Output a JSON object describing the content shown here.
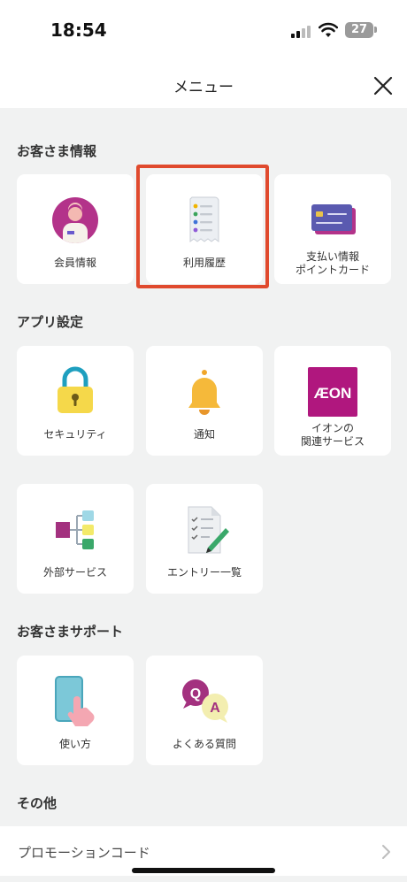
{
  "status_bar": {
    "time": "18:54",
    "battery": "27"
  },
  "header": {
    "title": "メニュー"
  },
  "sections": {
    "customer_info": {
      "title": "お客さま情報",
      "items": [
        {
          "label": "会員情報",
          "icon": "member-icon"
        },
        {
          "label": "利用履歴",
          "icon": "receipt-icon"
        },
        {
          "label": "支払い情報\nポイントカード",
          "icon": "card-icon"
        }
      ]
    },
    "app_settings": {
      "title": "アプリ設定",
      "items": [
        {
          "label": "セキュリティ",
          "icon": "lock-icon"
        },
        {
          "label": "通知",
          "icon": "bell-icon"
        },
        {
          "label": "イオンの\n関連サービス",
          "icon": "aeon-logo-icon"
        },
        {
          "label": "外部サービス",
          "icon": "connection-icon"
        },
        {
          "label": "エントリー一覧",
          "icon": "checklist-icon"
        }
      ]
    },
    "support": {
      "title": "お客さまサポート",
      "items": [
        {
          "label": "使い方",
          "icon": "phone-tap-icon"
        },
        {
          "label": "よくある質問",
          "icon": "qa-icon"
        }
      ]
    },
    "other": {
      "title": "その他",
      "items": [
        {
          "label": "プロモーションコード"
        }
      ]
    }
  },
  "logo_text": "ÆON",
  "faq_icon_letters": {
    "q": "Q",
    "a": "A"
  },
  "colors": {
    "highlight": "#e04a2e",
    "aeon": "#b0177e",
    "accent_purple": "#a3317f"
  }
}
